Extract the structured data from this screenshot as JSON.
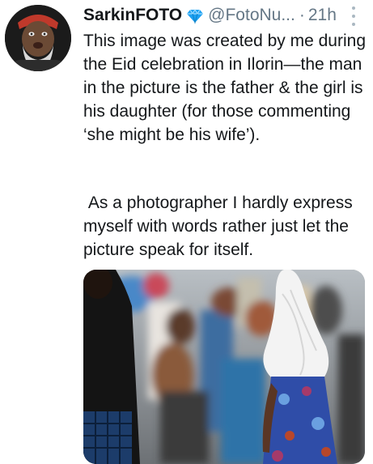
{
  "tweet": {
    "display_name": "SarkinFOTO",
    "verified_icon": "gem-icon",
    "handle": "@FotoNu...",
    "separator": "·",
    "time": "21h",
    "paragraph1": "This image was created by me during the Eid celebration in Ilorin—the man in the picture is the father & the girl is his daughter (for those commenting ‘she might be his wife’).",
    "paragraph2": " As a photographer I hardly express myself with words rather just let the picture speak for itself."
  },
  "icons": {
    "more": "more-vertical-icon"
  },
  "colors": {
    "text": "#14171a",
    "muted": "#657786",
    "verified": "#1da1f2"
  }
}
